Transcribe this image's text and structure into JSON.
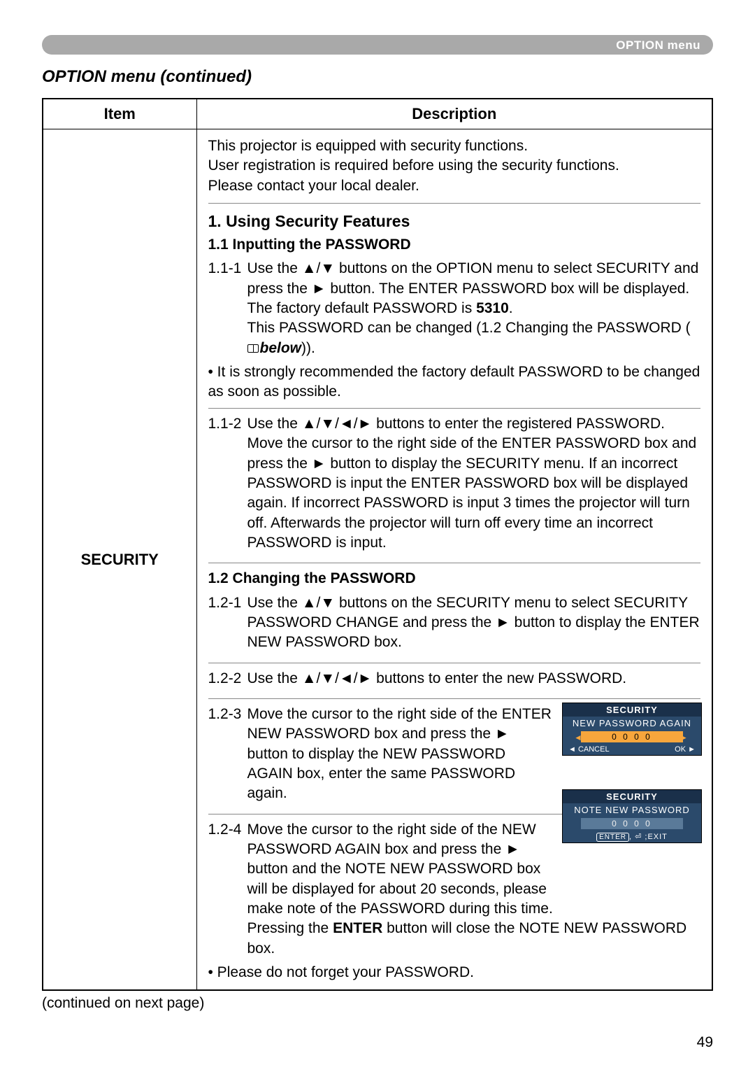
{
  "header_tab": "OPTION menu",
  "section_title": "OPTION menu (continued)",
  "table": {
    "col_item": "Item",
    "col_desc": "Description",
    "item_name": "SECURITY",
    "intro_l1": "This projector is equipped with security functions.",
    "intro_l2": "User registration is required before using the security functions.",
    "intro_l3": "Please contact your local dealer.",
    "h1": "1. Using Security Features",
    "s11_title": "1.1 Inputting the PASSWORD",
    "s11_1_num": "1.1-1",
    "s11_1_a": "Use the ▲/▼ buttons on the OPTION menu to select SECURITY and press the ► button. The ENTER PASSWORD box will be displayed.",
    "s11_1_b_pre": "The factory default PASSWORD is ",
    "s11_1_b_bold": "5310",
    "s11_1_b_post": ".",
    "s11_1_c": "This PASSWORD can be changed (1.2 Changing the PASSWORD (",
    "s11_1_c_ref": "below",
    "s11_1_c_end": ")).",
    "s11_1_note": "• It is strongly recommended the factory default PASSWORD to be changed as soon as possible.",
    "s11_2_num": "1.1-2",
    "s11_2": "Use the ▲/▼/◄/► buttons to enter the registered PASSWORD. Move the cursor to the right side of the ENTER PASSWORD box and press the ► button to display the SECURITY menu. If an incorrect PASSWORD is input the ENTER PASSWORD box will be displayed again. If incorrect PASSWORD is input 3 times the projector will turn off. Afterwards the projector will turn off every time an incorrect PASSWORD is input.",
    "s12_title": "1.2 Changing the PASSWORD",
    "s12_1_num": "1.2-1",
    "s12_1": "Use the ▲/▼ buttons on the SECURITY menu to select SECURITY PASSWORD CHANGE and press the ► button to display the ENTER NEW PASSWORD box.",
    "s12_2_num": "1.2-2",
    "s12_2": "Use the ▲/▼/◄/► buttons to enter the new PASSWORD.",
    "s12_3_num": "1.2-3",
    "s12_3": "Move the cursor to the right side of the ENTER NEW PASSWORD box and press the ► button to display the NEW PASSWORD AGAIN box, enter the same PASSWORD again.",
    "s12_4_num": "1.2-4",
    "s12_4_a": "Move the cursor to the right side of the NEW PASSWORD AGAIN box and press the ► button and the NOTE NEW PASSWORD box will be displayed for about 20 seconds, please make note of the PASSWORD during this time.",
    "s12_4_b_pre": "Pressing the ",
    "s12_4_b_bold": "ENTER",
    "s12_4_b_post": " button will close the NOTE NEW PASSWORD box.",
    "s12_4_note": "• Please do not forget your PASSWORD."
  },
  "dlg1": {
    "title": "SECURITY",
    "sub": "NEW PASSWORD AGAIN",
    "digits": "0 0 0 0",
    "left": "◄ CANCEL",
    "right": "OK ►"
  },
  "dlg2": {
    "title": "SECURITY",
    "sub": "NOTE NEW PASSWORD",
    "digits": "0 0 0 0",
    "foot_enter": "ENTER",
    "foot_rest": ", ⏎ ;EXIT"
  },
  "cont_next": "(continued on next page)",
  "page_num": "49"
}
